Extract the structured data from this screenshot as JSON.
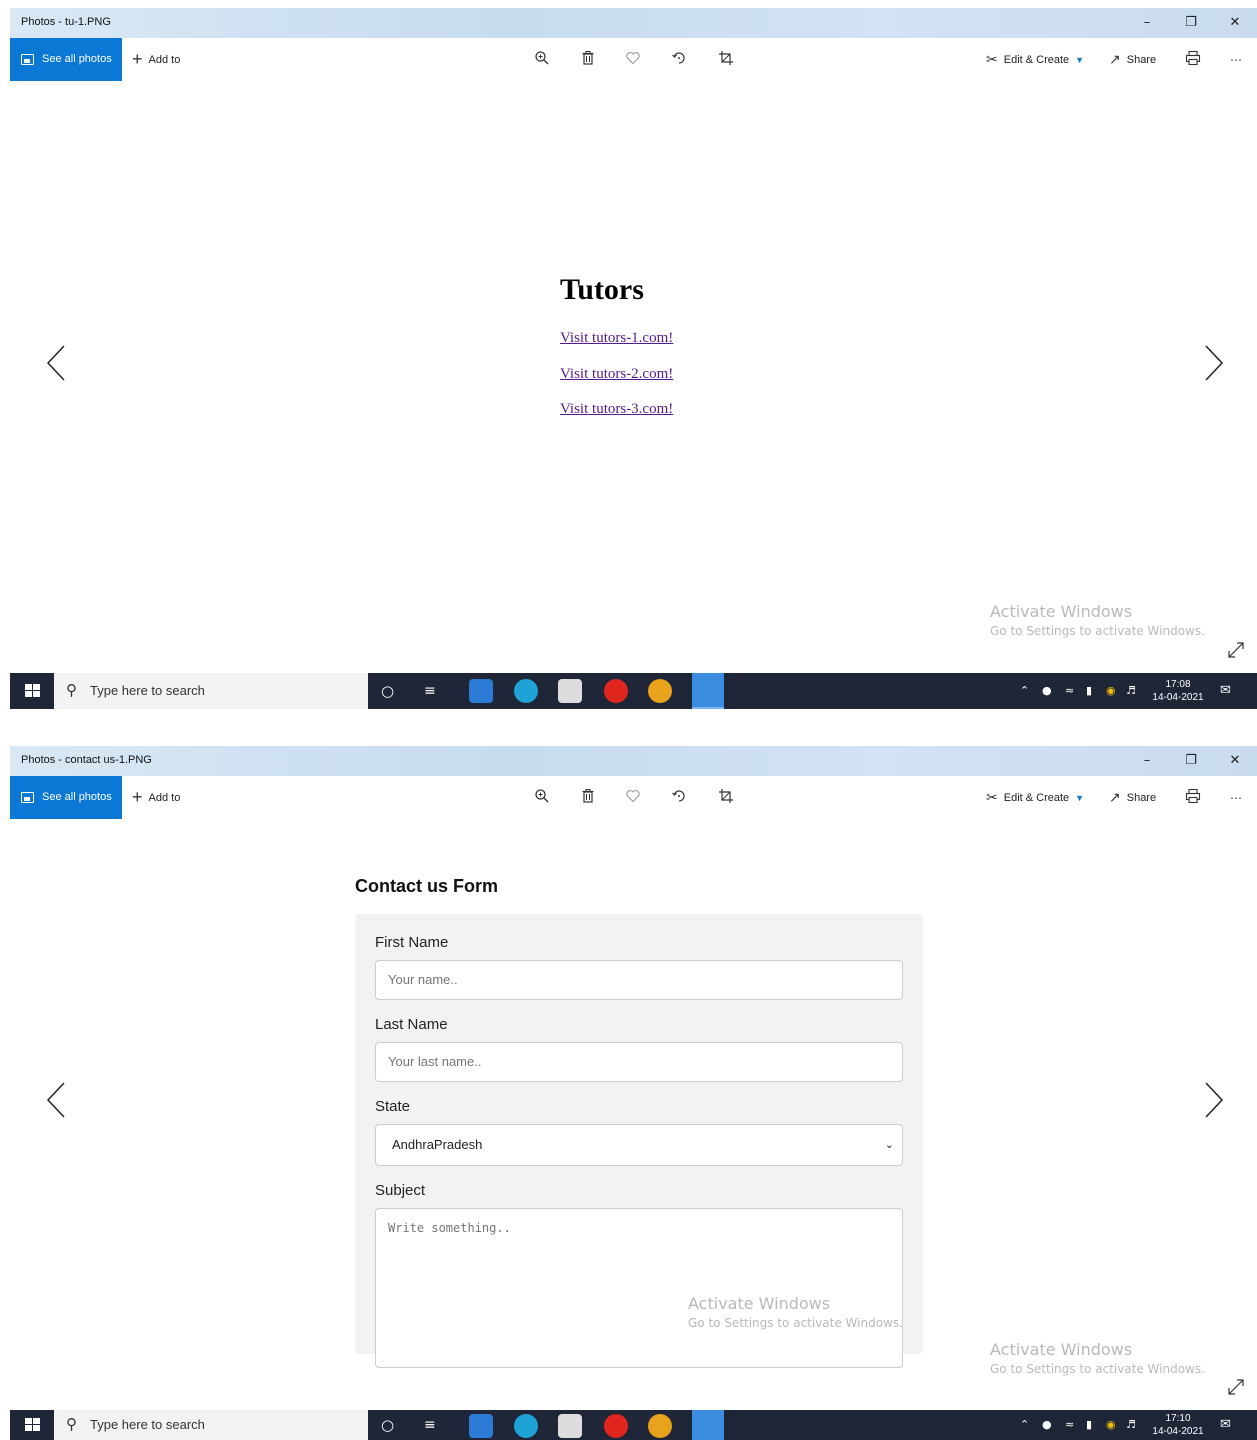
{
  "screens": [
    {
      "window_title": "Photos - tu-1.PNG",
      "toolbar": {
        "see_all_photos": "See all photos",
        "add_to": "Add to",
        "edit_create": "Edit & Create",
        "share": "Share"
      },
      "content": {
        "heading": "Tutors",
        "links": [
          "Visit tutors-1.com!",
          "Visit tutors-2.com!",
          "Visit tutors-3.com!"
        ]
      },
      "watermark": {
        "title": "Activate Windows",
        "subtitle": "Go to Settings to activate Windows."
      },
      "taskbar": {
        "search_placeholder": "Type here to search",
        "time": "17:08",
        "date": "14-04-2021"
      }
    },
    {
      "window_title": "Photos - contact us-1.PNG",
      "toolbar": {
        "see_all_photos": "See all photos",
        "add_to": "Add to",
        "edit_create": "Edit & Create",
        "share": "Share"
      },
      "content": {
        "form_title": "Contact us Form",
        "first_name_label": "First Name",
        "first_name_placeholder": "Your name..",
        "last_name_label": "Last Name",
        "last_name_placeholder": "Your last name..",
        "state_label": "State",
        "state_value": "AndhraPradesh",
        "subject_label": "Subject",
        "subject_placeholder": "Write something.."
      },
      "inner_watermark": {
        "title": "Activate Windows",
        "subtitle": "Go to Settings to activate Windows."
      },
      "watermark": {
        "title": "Activate Windows",
        "subtitle": "Go to Settings to activate Windows."
      },
      "taskbar": {
        "search_placeholder": "Type here to search",
        "time": "17:10",
        "date": "14-04-2021"
      }
    }
  ],
  "colors": {
    "accent": "#0a78d4",
    "visited_link": "#551a8b",
    "taskbar": "#1f2637",
    "form_bg": "#f2f2f2"
  }
}
